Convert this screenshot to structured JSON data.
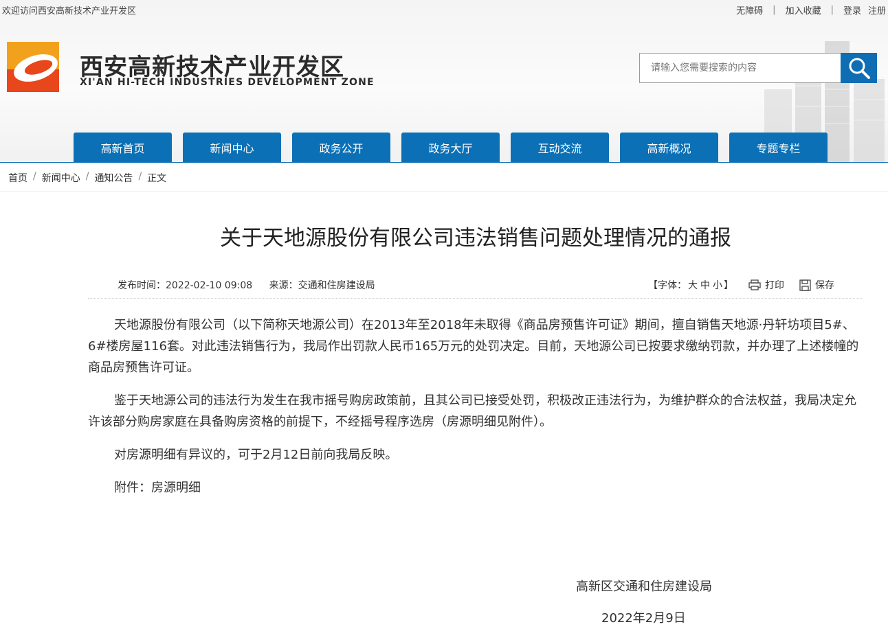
{
  "topbar": {
    "welcome": "欢迎访问西安高新技术产业开发区",
    "accessibility": "无障碍",
    "favorite": "加入收藏",
    "login": "登录",
    "register": "注册",
    "separator": "|"
  },
  "logo": {
    "cn": "西安高新技术产业开发区",
    "en": "XI'AN HI-TECH INDUSTRIES DEVELOPMENT ZONE"
  },
  "search": {
    "placeholder": "请输入您需要搜索的内容",
    "value": "",
    "icon": "search-icon"
  },
  "nav": [
    "高新首页",
    "新闻中心",
    "政务公开",
    "政务大厅",
    "互动交流",
    "高新概况",
    "专题专栏"
  ],
  "breadcrumb": [
    "首页",
    "新闻中心",
    "通知公告",
    "正文"
  ],
  "breadcrumb_separator": "/",
  "article": {
    "title": "关于天地源股份有限公司违法销售问题处理情况的通报",
    "publish_label": "发布时间：",
    "publish_time": "2022-02-10 09:08",
    "source_label": "来源：",
    "source": "交通和住房建设局",
    "font_prefix": "【字体：",
    "font_large": "大",
    "font_medium": "中",
    "font_small": "小",
    "font_suffix": "】",
    "print": "打印",
    "save": "保存",
    "paragraphs": [
      "天地源股份有限公司（以下简称天地源公司）在2013年至2018年未取得《商品房预售许可证》期间，擅自销售天地源·丹轩坊项目5#、6#楼房屋116套。对此违法销售行为，我局作出罚款人民币165万元的处罚决定。目前，天地源公司已按要求缴纳罚款，并办理了上述楼幢的商品房预售许可证。",
      "鉴于天地源公司的违法行为发生在我市摇号购房政策前，且其公司已接受处罚，积极改正违法行为，为维护群众的合法权益，我局决定允许该部分购房家庭在具备购房资格的前提下，不经摇号程序选房（房源明细见附件）。",
      "对房源明细有异议的，可于2月12日前向我局反映。",
      "附件：房源明细"
    ],
    "signature": "高新区交通和住房建设局",
    "date": "2022年2月9日"
  },
  "colors": {
    "primary": "#0b70b5",
    "logo_orange": "#f2a11c",
    "logo_red": "#e8461b"
  }
}
